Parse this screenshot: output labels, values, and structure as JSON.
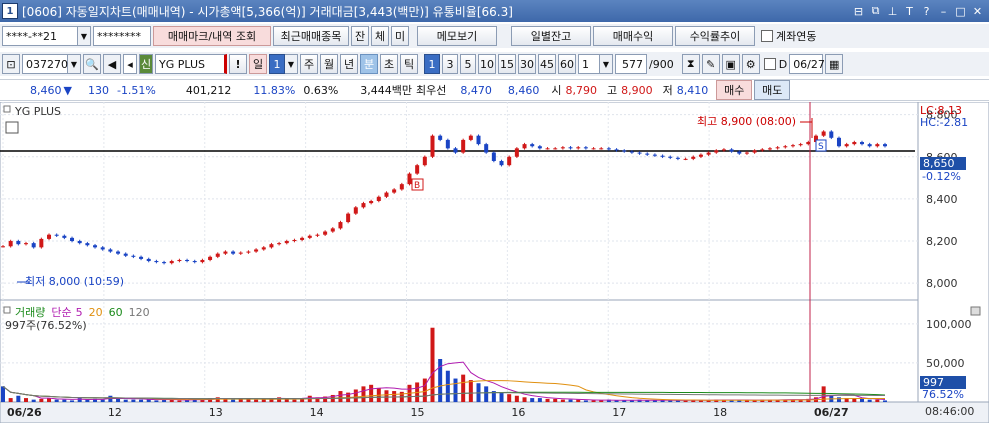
{
  "title": {
    "num": "1",
    "text": "[0606] 자동일지차트(매매내역) - 시가총액[5,366(억)] 거래대금[3,443(백만)] 유통비율[66.3]"
  },
  "toolbar1": {
    "account": "****-**21",
    "password": "********",
    "trade_mark_btn": "매매마크/내역 조회",
    "recent_btn": "최근매매종목",
    "jan": "잔",
    "che": "체",
    "mi": "미",
    "memo_btn": "메모보기",
    "daily_btn": "일별잔고",
    "profit_btn": "매매수익",
    "trend_btn": "수익률추이",
    "link_label": "계좌연동"
  },
  "toolbar2": {
    "code": "037270",
    "badge": "신",
    "name": "YG PLUS",
    "period_il": "일",
    "period_val": "1",
    "periods": [
      "주",
      "월",
      "년",
      "분",
      "초",
      "틱"
    ],
    "intervals": [
      "1",
      "3",
      "5",
      "10",
      "15",
      "30",
      "45",
      "60"
    ],
    "count_val": "1",
    "range": "577",
    "range_total": "/900",
    "d_label": "D",
    "date": "06/27"
  },
  "quote": {
    "price": "8,460",
    "arrow": "▼",
    "change": "130",
    "pct": "-1.51%",
    "volume": "401,212",
    "vol_pct": "11.83%",
    "turnover": "0.63%",
    "amount": "3,444백만",
    "best_label": "최우선",
    "ask": "8,470",
    "bid": "8,460",
    "open_label": "시",
    "open": "8,790",
    "high_label": "고",
    "high": "8,900",
    "low_label": "저",
    "low": "8,410",
    "buy_btn": "매수",
    "sell_btn": "매도"
  },
  "chart_data": {
    "type": "line",
    "title": "YG PLUS",
    "ylim": [
      7920,
      8860
    ],
    "yticks": [
      "8,800",
      "8,600",
      "8,400",
      "8,200",
      "8,000"
    ],
    "max_label": "최고 8,900 (08:00)",
    "min_label": "최저 8,000 (10:59)",
    "lc": "LC:8.13",
    "hc": "HC:-2.81",
    "last_price": "8,650",
    "last_pct": "-0.12%",
    "x_labels": [
      "06/26",
      "12",
      "13",
      "14",
      "15",
      "16",
      "17",
      "18",
      "06/27"
    ],
    "time": "08:46:00",
    "volume_legend": [
      "거래량",
      "단순",
      "5",
      "20",
      "60",
      "120"
    ],
    "volume_sub": "997주(76.52%)",
    "vol_ticks": [
      "100,000",
      "50,000"
    ],
    "vol_last": "997",
    "vol_last_pct": "76.52%",
    "price_series": [
      8175,
      8200,
      8185,
      8190,
      8170,
      8210,
      8230,
      8225,
      8215,
      8200,
      8190,
      8180,
      8170,
      8160,
      8150,
      8140,
      8130,
      8125,
      8115,
      8105,
      8100,
      8095,
      8105,
      8110,
      8105,
      8100,
      8110,
      8125,
      8140,
      8150,
      8140,
      8145,
      8150,
      8160,
      8170,
      8185,
      8190,
      8200,
      8205,
      8215,
      8225,
      8230,
      8245,
      8260,
      8290,
      8330,
      8360,
      8380,
      8390,
      8410,
      8430,
      8445,
      8470,
      8520,
      8560,
      8600,
      8700,
      8680,
      8640,
      8620,
      8680,
      8700,
      8660,
      8620,
      8580,
      8560,
      8600,
      8640,
      8660,
      8650,
      8640,
      8640,
      8640,
      8645,
      8640,
      8645,
      8640,
      8640,
      8640,
      8635,
      8630,
      8625,
      8620,
      8615,
      8610,
      8605,
      8600,
      8595,
      8590,
      8590,
      8600,
      8610,
      8620,
      8630,
      8635,
      8625,
      8615,
      8620,
      8630,
      8635,
      8640,
      8645,
      8650,
      8655,
      8660,
      8670,
      8700,
      8720,
      8690,
      8650,
      8660,
      8670,
      8660,
      8650,
      8660,
      8650
    ],
    "volume_series": [
      20,
      5,
      8,
      5,
      3,
      4,
      5,
      3,
      3,
      2,
      5,
      3,
      4,
      3,
      8,
      4,
      3,
      3,
      3,
      4,
      2,
      3,
      3,
      2,
      2,
      4,
      3,
      5,
      6,
      4,
      3,
      4,
      5,
      3,
      4,
      5,
      6,
      4,
      3,
      5,
      8,
      6,
      7,
      9,
      14,
      12,
      16,
      20,
      22,
      18,
      15,
      14,
      13,
      22,
      25,
      30,
      95,
      55,
      40,
      30,
      35,
      28,
      24,
      20,
      14,
      12,
      10,
      8,
      6,
      5,
      5,
      4,
      4,
      3,
      3,
      3,
      2,
      2,
      2,
      3,
      2,
      2,
      2,
      3,
      2,
      2,
      2,
      2,
      2,
      2,
      3,
      2,
      2,
      3,
      3,
      3,
      2,
      2,
      2,
      3,
      3,
      3,
      3,
      3,
      3,
      4,
      6,
      20,
      8,
      6,
      5,
      4,
      4,
      3,
      3,
      2
    ]
  }
}
